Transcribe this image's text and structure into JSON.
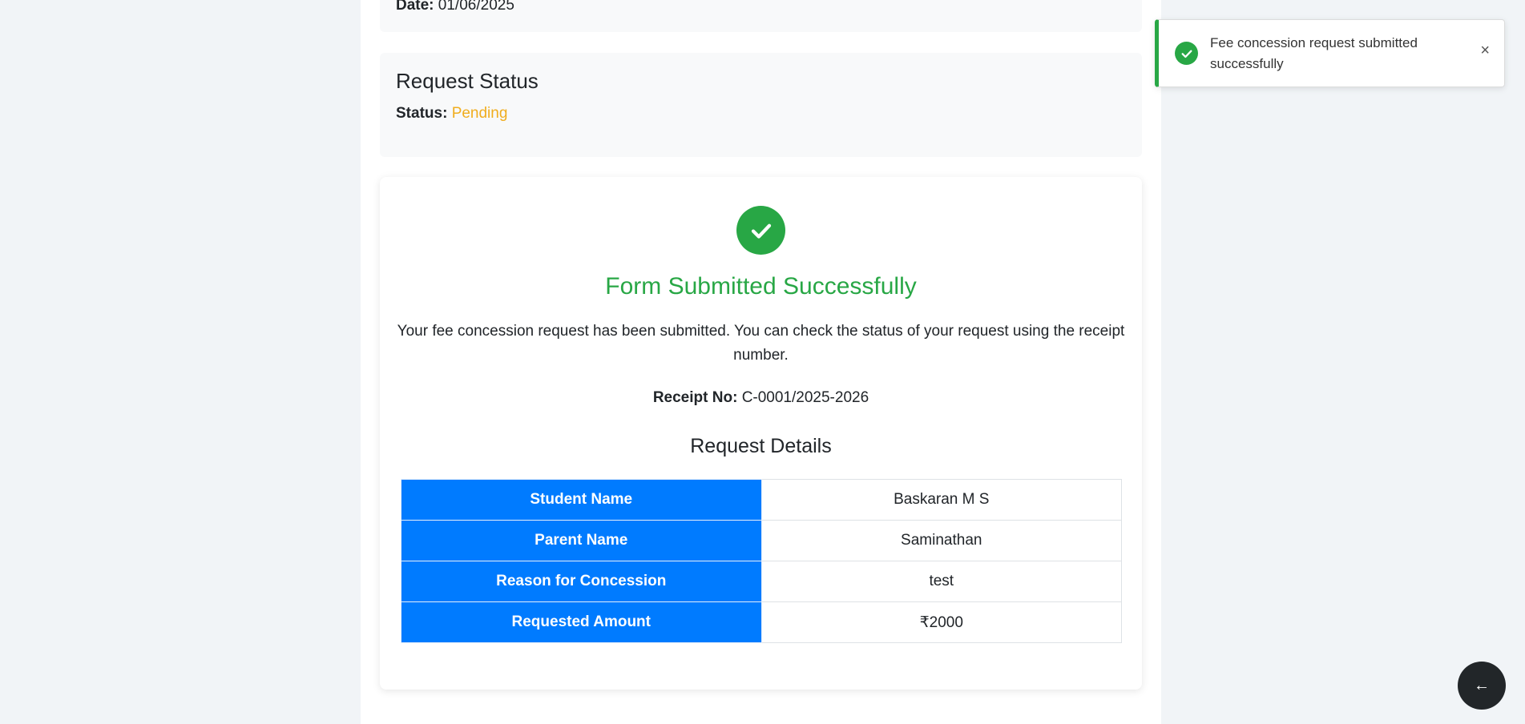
{
  "request_info": {
    "date_label": "Date:",
    "date_value": "01/06/2025"
  },
  "request_status": {
    "title": "Request Status",
    "status_label": "Status:",
    "status_value": "Pending",
    "status_color": "#f0ad1e"
  },
  "success": {
    "icon": "check-circle-icon",
    "title": "Form Submitted Successfully",
    "message": "Your fee concession request has been submitted. You can check the status of your request using the receipt number.",
    "receipt_label": "Receipt No:",
    "receipt_value": "C-0001/2025-2026",
    "accent_color": "#28a745"
  },
  "request_details": {
    "title": "Request Details",
    "header_color": "#007bff",
    "rows": [
      {
        "label": "Student Name",
        "value": "Baskaran M S"
      },
      {
        "label": "Parent Name",
        "value": "Saminathan"
      },
      {
        "label": "Reason for Concession",
        "value": "test"
      },
      {
        "label": "Requested Amount",
        "value": "₹2000"
      }
    ]
  },
  "toast": {
    "message": "Fee concession request submitted successfully",
    "icon": "check-icon",
    "close_label": "×"
  },
  "fab": {
    "icon": "arrow-left-icon",
    "label": "←"
  }
}
